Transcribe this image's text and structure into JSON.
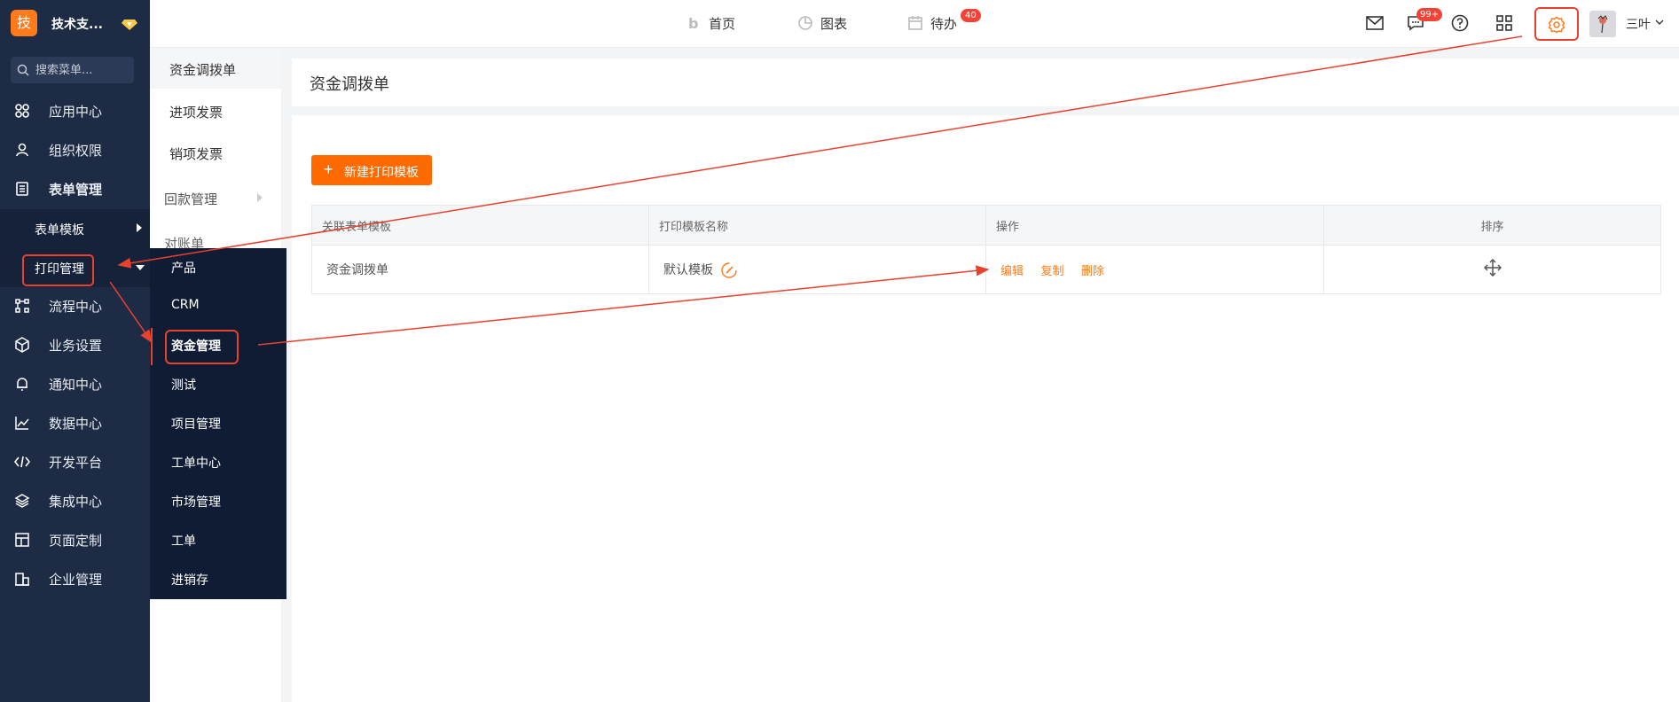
{
  "brand": {
    "logo_char": "技",
    "name": "技术支..."
  },
  "search": {
    "placeholder": "搜索菜单..."
  },
  "sidebar": {
    "items": [
      {
        "label": "应用中心",
        "icon": "grid-icon"
      },
      {
        "label": "组织权限",
        "icon": "user-icon"
      },
      {
        "label": "表单管理",
        "icon": "form-icon"
      },
      {
        "label": "流程中心",
        "icon": "flow-icon"
      },
      {
        "label": "业务设置",
        "icon": "cube-icon"
      },
      {
        "label": "通知中心",
        "icon": "bell-icon"
      },
      {
        "label": "数据中心",
        "icon": "chart-icon"
      },
      {
        "label": "开发平台",
        "icon": "code-icon"
      },
      {
        "label": "集成中心",
        "icon": "layers-icon"
      },
      {
        "label": "页面定制",
        "icon": "layout-icon"
      },
      {
        "label": "企业管理",
        "icon": "building-icon"
      }
    ],
    "sub_items": [
      {
        "label": "表单模板"
      },
      {
        "label": "打印管理"
      }
    ]
  },
  "column2": {
    "items": [
      {
        "label": "资金调拨单"
      },
      {
        "label": "进项发票"
      },
      {
        "label": "销项发票"
      },
      {
        "label": "回款管理"
      },
      {
        "label": "对账单"
      }
    ]
  },
  "flyout": {
    "items": [
      {
        "label": "产品"
      },
      {
        "label": "CRM"
      },
      {
        "label": "资金管理"
      },
      {
        "label": "测试"
      },
      {
        "label": "项目管理"
      },
      {
        "label": "工单中心"
      },
      {
        "label": "市场管理"
      },
      {
        "label": "工单"
      },
      {
        "label": "进销存"
      }
    ]
  },
  "header": {
    "tabs": [
      {
        "label": "首页",
        "icon": "home-icon"
      },
      {
        "label": "图表",
        "icon": "pie-chart-icon"
      },
      {
        "label": "待办",
        "icon": "calendar-icon",
        "badge": "40"
      }
    ],
    "message_badge": "99+",
    "username": "三叶"
  },
  "main": {
    "title": "资金调拨单",
    "new_button": "新建打印模板",
    "table": {
      "headers": [
        "关联表单模板",
        "打印模板名称",
        "操作",
        "排序"
      ],
      "rows": [
        {
          "form": "资金调拨单",
          "template": "默认模板",
          "actions": [
            "编辑",
            "复制",
            "删除"
          ]
        }
      ]
    }
  },
  "colors": {
    "accent": "#ff6a00",
    "sidebar_bg": "#1d2b45",
    "annotation": "#e8412e"
  }
}
